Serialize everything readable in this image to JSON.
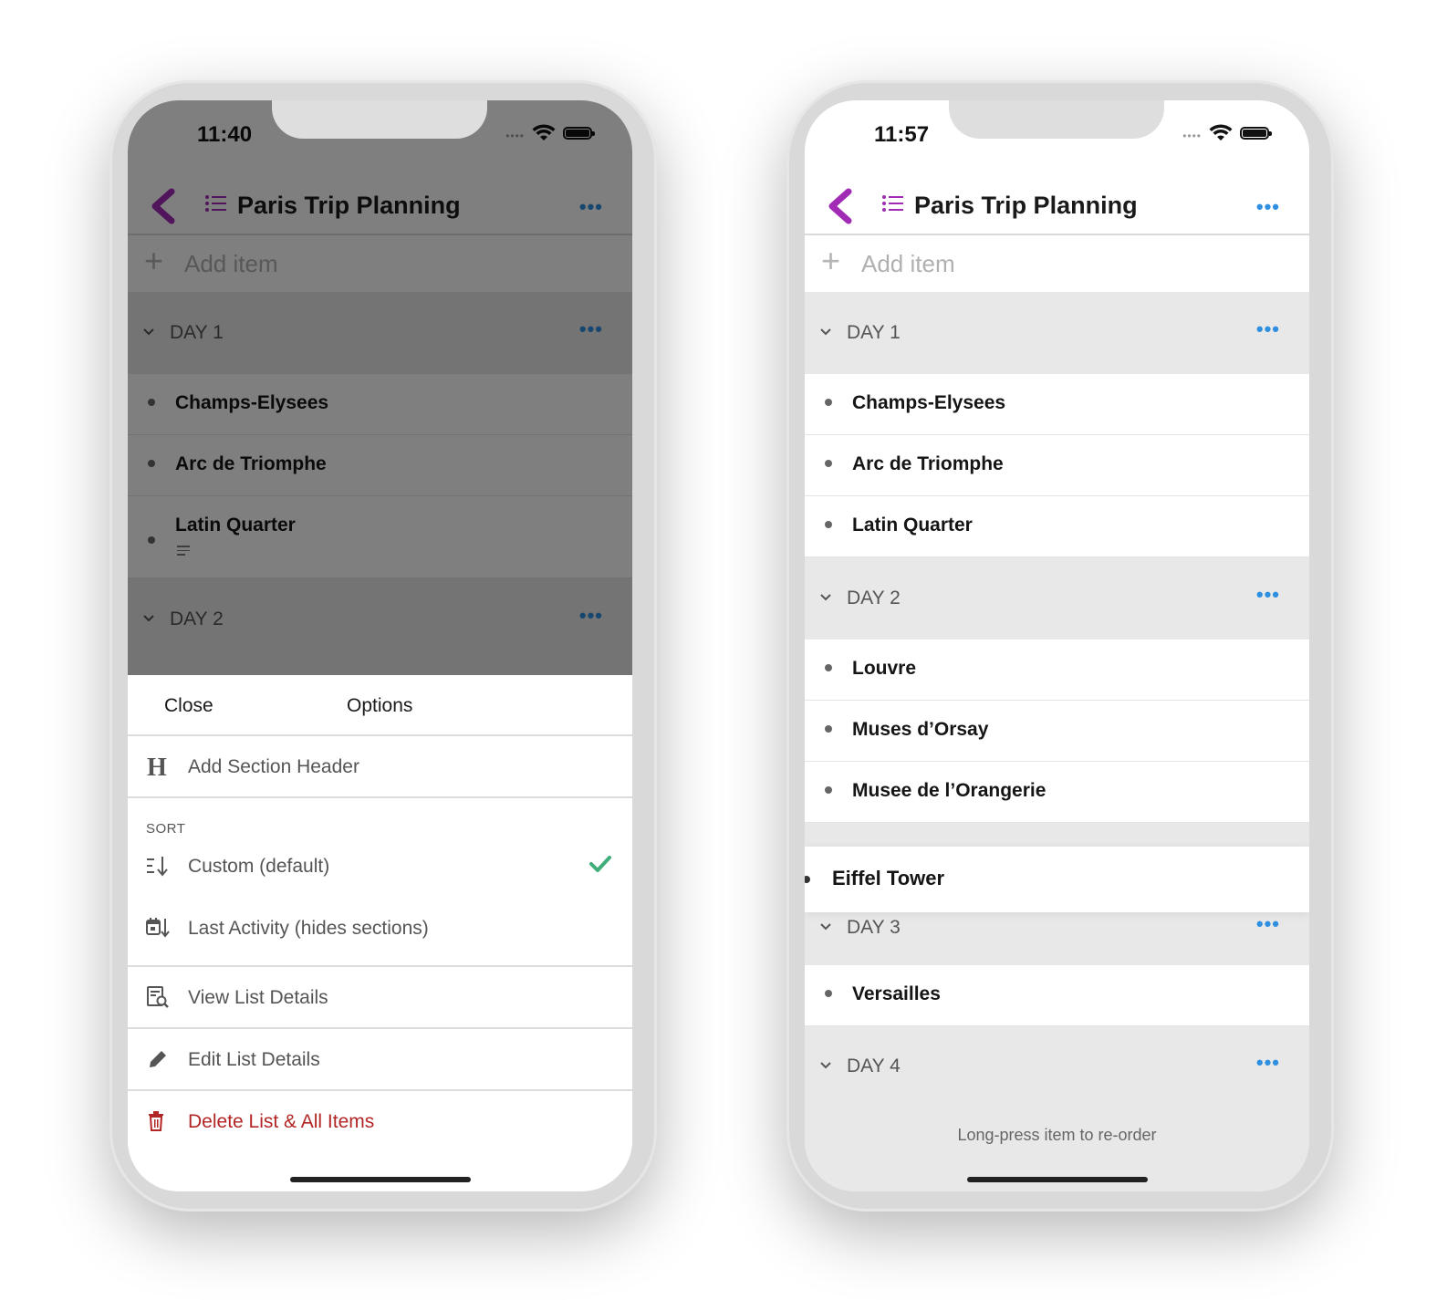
{
  "left_phone": {
    "status_time": "11:40",
    "header_title": "Paris Trip Planning",
    "add_item_placeholder": "Add item",
    "sections": [
      {
        "title": "DAY 1",
        "items": [
          "Champs-Elysees",
          "Arc de Triomphe",
          "Latin Quarter"
        ]
      },
      {
        "title": "DAY 2",
        "items": []
      }
    ],
    "sheet": {
      "close_label": "Close",
      "title": "Options",
      "add_section_header": "Add Section Header",
      "sort_label": "SORT",
      "sort_custom": "Custom (default)",
      "sort_last_activity": "Last Activity (hides sections)",
      "view_details": "View List Details",
      "edit_details": "Edit List Details",
      "delete_list": "Delete List & All Items"
    }
  },
  "right_phone": {
    "status_time": "11:57",
    "header_title": "Paris Trip Planning",
    "add_item_placeholder": "Add item",
    "sections": [
      {
        "title": "DAY 1",
        "items": [
          "Champs-Elysees",
          "Arc de Triomphe",
          "Latin Quarter"
        ]
      },
      {
        "title": "DAY 2",
        "items": [
          "Louvre",
          "Muses d’Orsay",
          "Musee de l’Orangerie"
        ]
      },
      {
        "title": "DAY 3",
        "items": [
          "Versailles"
        ]
      },
      {
        "title": "DAY 4",
        "items": []
      }
    ],
    "dragging_item": "Eiffel Tower",
    "footer_hint": "Long-press item to re-order"
  },
  "colors": {
    "accent_purple": "#a12bb5",
    "link_blue": "#2f8fe0",
    "danger_red": "#b32626",
    "check_green": "#3fae7a"
  }
}
